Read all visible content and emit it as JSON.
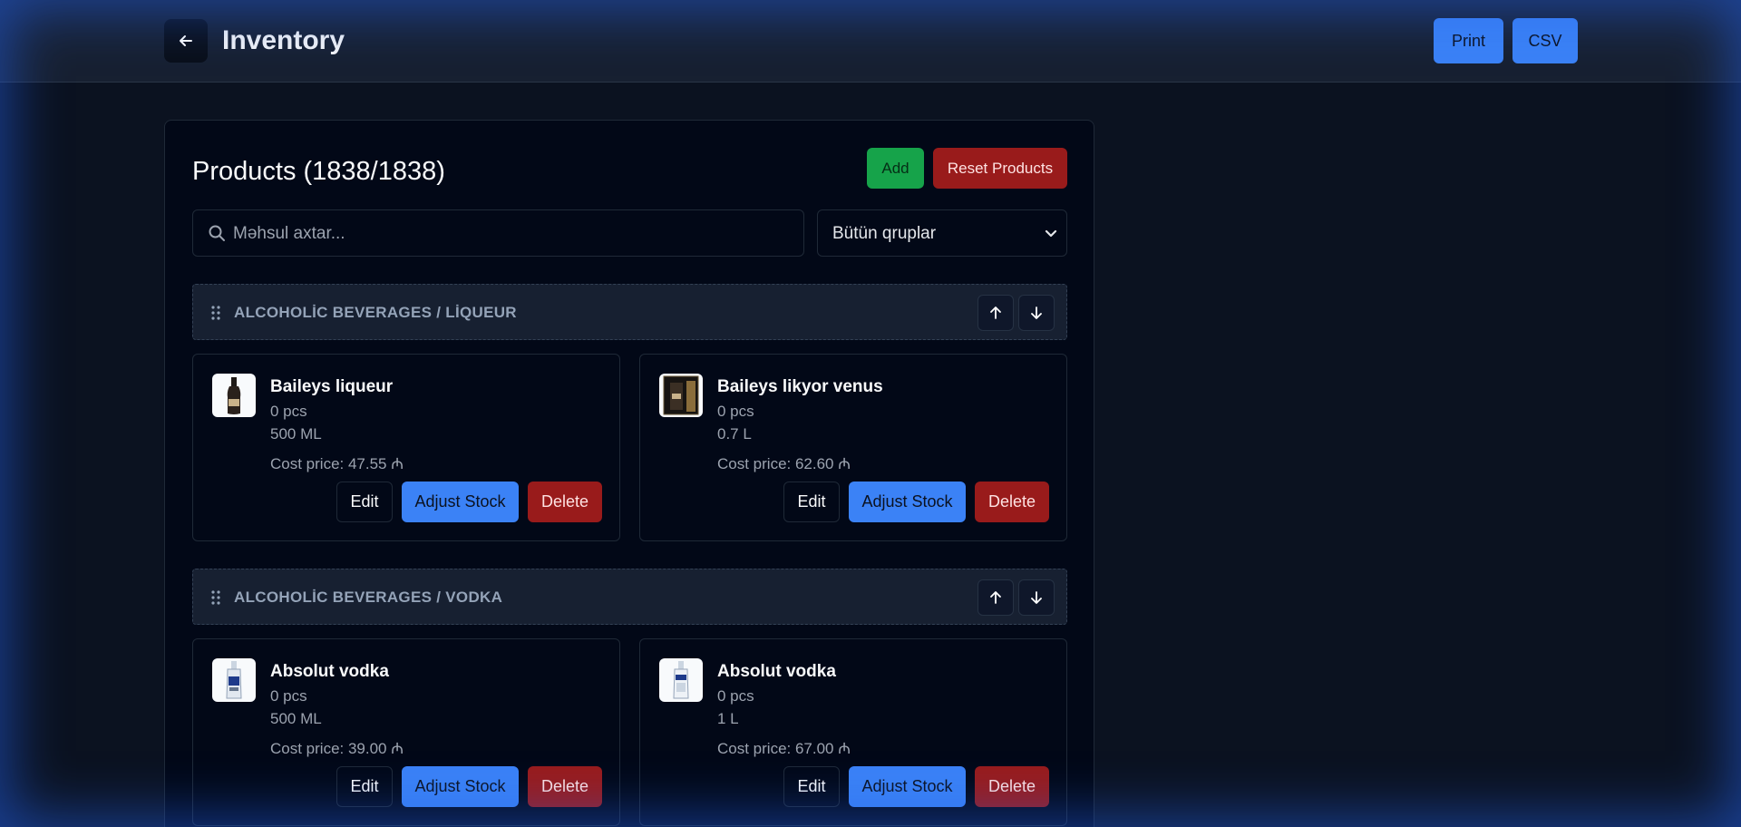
{
  "header": {
    "title": "Inventory",
    "print_label": "Print",
    "csv_label": "CSV"
  },
  "products_panel": {
    "title": "Products (1838/1838)",
    "add_label": "Add",
    "reset_label": "Reset Products",
    "search_placeholder": "Məhsul axtar...",
    "group_filter": "Bütün qruplar"
  },
  "groups": [
    {
      "name": "ALCOHOLİC BEVERAGES / LİQUEUR",
      "products": [
        {
          "name": "Baileys liqueur",
          "qty": "0 pcs",
          "volume": "500 ML",
          "cost": "Cost price: 47.55 ₼",
          "thumb": "bottle-dark"
        },
        {
          "name": "Baileys likyor venus",
          "qty": "0 pcs",
          "volume": "0.7 L",
          "cost": "Cost price: 62.60 ₼",
          "thumb": "gift-box"
        }
      ]
    },
    {
      "name": "ALCOHOLİC BEVERAGES / VODKA",
      "products": [
        {
          "name": "Absolut vodka",
          "qty": "0 pcs",
          "volume": "500 ML",
          "cost": "Cost price: 39.00 ₼",
          "thumb": "bottle-clear"
        },
        {
          "name": "Absolut vodka",
          "qty": "0 pcs",
          "volume": "1 L",
          "cost": "Cost price: 67.00 ₼",
          "thumb": "bottle-clear"
        }
      ]
    }
  ],
  "card_actions": {
    "edit_label": "Edit",
    "adjust_label": "Adjust Stock",
    "delete_label": "Delete"
  },
  "colors": {
    "accent": "#3b82f6",
    "success": "#16a34a",
    "danger": "#991b1b",
    "background": "#0b1220"
  }
}
